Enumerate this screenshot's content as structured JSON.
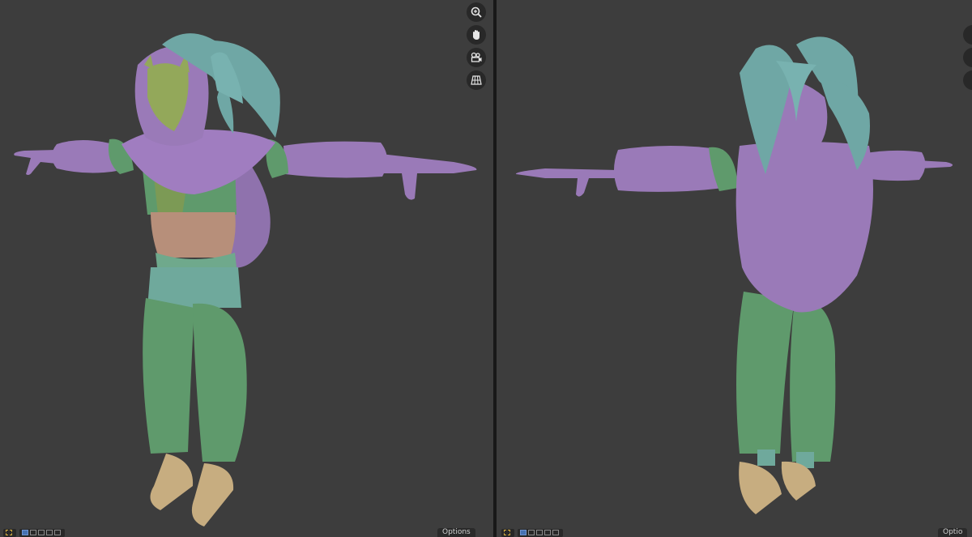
{
  "viewport_left": {
    "options_label": "Options"
  },
  "viewport_right": {
    "options_label": "Optio"
  },
  "colors": {
    "background": "#3d3d3d",
    "divider": "#181818",
    "teal_hat": "#6fa7a5",
    "purple_cloth": "#9a7ab8",
    "green_cloth": "#5f9a6c",
    "olive_mask": "#93a85a",
    "corset": "#b78f7a",
    "boots": "#c7ad80",
    "active_tool": "#4772b3"
  },
  "icons": [
    "zoom-icon",
    "hand-pan-icon",
    "camera-icon",
    "grid-view-icon"
  ]
}
